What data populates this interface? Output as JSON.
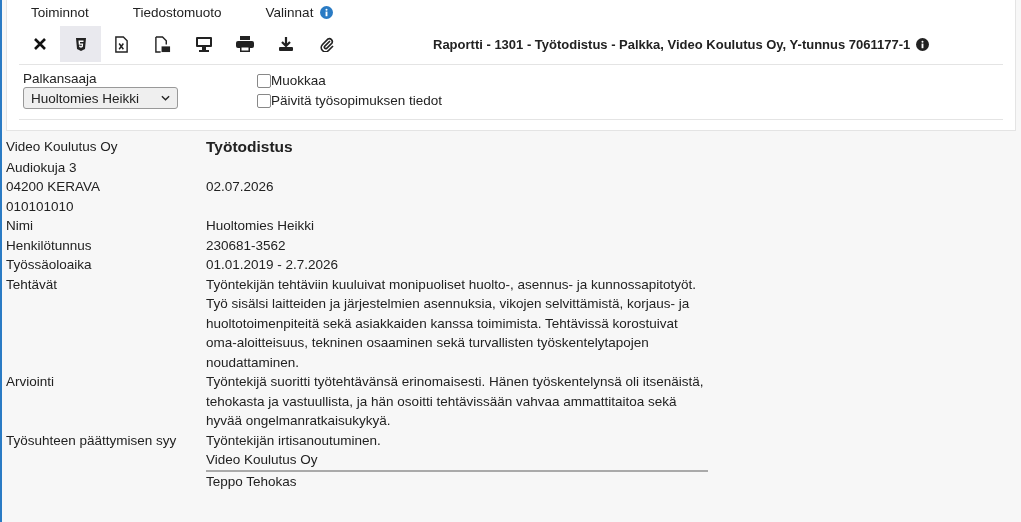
{
  "menu": [
    {
      "label": "Toiminnot"
    },
    {
      "label": "Tiedostomuoto"
    },
    {
      "label": "Valinnat",
      "info": true
    }
  ],
  "toolbar": [
    {
      "kind": "close",
      "selected": false
    },
    {
      "kind": "html",
      "selected": true
    },
    {
      "kind": "excel",
      "selected": false
    },
    {
      "kind": "pdf",
      "selected": false
    },
    {
      "kind": "screen",
      "selected": false
    },
    {
      "kind": "print",
      "selected": false
    },
    {
      "kind": "download",
      "selected": false
    },
    {
      "kind": "attach",
      "selected": false
    }
  ],
  "report_title": "Raportti - 1301 - Työtodistus - Palkka, Video Koulutus Oy, Y-tunnus 7061177-1",
  "payee": {
    "label": "Palkansaaja",
    "value": "Huoltomies Heikki"
  },
  "options": [
    {
      "label": "Muokkaa",
      "checked": false
    },
    {
      "label": "Päivitä työsopimuksen tiedot",
      "checked": false
    }
  ],
  "document": {
    "title": "Työtodistus",
    "date": "02.07.2026",
    "sender": [
      "Video Koulutus Oy",
      "Audiokuja 3",
      "04200 KERAVA",
      "010101010"
    ],
    "fields": [
      {
        "label": "Nimi",
        "value": "Huoltomies Heikki"
      },
      {
        "label": "Henkilötunnus",
        "value": "230681-3562"
      },
      {
        "label": "Työssäoloaika",
        "value": "01.01.2019 - 2.7.2026"
      },
      {
        "label": "Tehtävät",
        "value": "Työntekijän tehtäviin kuuluivat monipuoliset huolto-, asennus- ja kunnossapitotyöt. Työ sisälsi laitteiden ja järjestelmien asennuksia, vikojen selvittämistä, korjaus- ja huoltotoimenpiteitä sekä asiakkaiden kanssa toimimista. Tehtävissä korostuivat oma-aloitteisuus, tekninen osaaminen sekä turvallisten työskentelytapojen noudattaminen."
      },
      {
        "label": "Arviointi",
        "value": "Työntekijä suoritti työtehtävänsä erinomaisesti. Hänen työskentelynsä oli itsenäistä, tehokasta ja vastuullista, ja hän osoitti tehtävissään vahvaa ammattitaitoa sekä hyvää ongelmanratkaisukykyä."
      },
      {
        "label": "Työsuhteen päättymisen syy",
        "value": "Työntekijän irtisanoutuminen."
      }
    ],
    "signature_company": "Video Koulutus Oy",
    "signer": "Teppo Tehokas"
  }
}
